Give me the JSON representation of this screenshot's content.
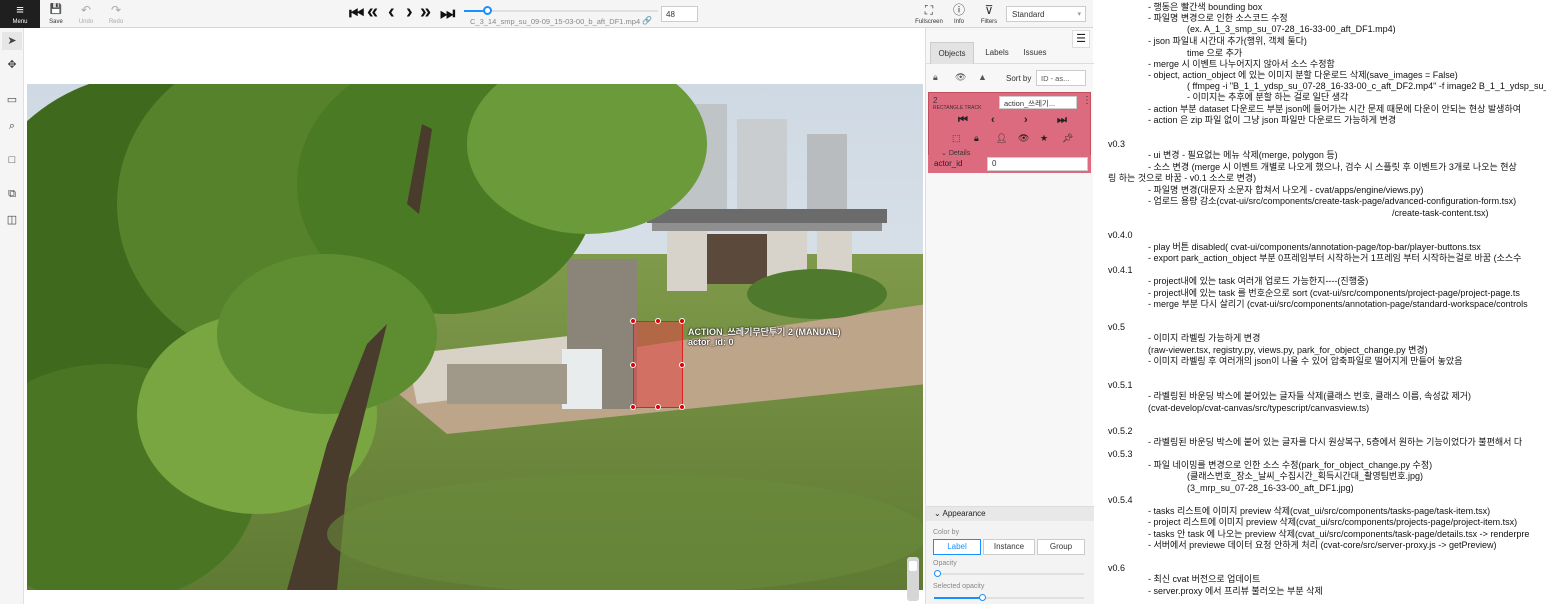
{
  "topbar": {
    "menu": {
      "icon": "≡",
      "label": "Menu"
    },
    "save": {
      "icon": "💾",
      "label": "Save"
    },
    "undo": {
      "icon": "↶",
      "label": "Undo"
    },
    "redo": {
      "icon": "↷",
      "label": "Redo"
    },
    "player": {
      "first": "⏮",
      "fast_back": "«",
      "back": "‹",
      "forward": "›",
      "fast_forward": "»",
      "last": "⏭"
    },
    "frame_progress": 0.12,
    "filename": "C_3_14_smp_su_09-09_15-03-00_b_aft_DF1.mp4",
    "frame_number": "48",
    "fullscreen": {
      "icon": "⛶",
      "label": "Fullscreen"
    },
    "info": {
      "icon": "ⓘ",
      "label": "Info"
    },
    "filters": {
      "icon": "⊽",
      "label": "Filters"
    },
    "workspace": "Standard"
  },
  "tools": [
    "cursor-icon",
    "move-icon",
    "rectangle-icon",
    "zoom-region-icon",
    "rectangle-icon",
    "merge-icon",
    "split-icon"
  ],
  "canvas": {
    "label_line1": "ACTION_쓰레기무단투기 2 (MANUAL)",
    "label_line2": "actor_id: 0"
  },
  "panel": {
    "tabs": [
      "Objects",
      "Labels",
      "Issues"
    ],
    "sort_label": "Sort by",
    "sort_value": "ID - as...",
    "object": {
      "id": "2",
      "kind": "RECTANGLE TRACK",
      "label": "action_쓰레기...",
      "details": "Details",
      "attr_name": "actor_id",
      "attr_value": "0"
    },
    "appearance": {
      "title": "Appearance",
      "color_by": "Color by",
      "options": [
        "Label",
        "Instance",
        "Group"
      ],
      "opacity": "Opacity",
      "opacity_value": 0.0,
      "selected_opacity": "Selected opacity",
      "selected_opacity_value": 0.32
    }
  },
  "notes": [
    "- 행동은 빨간색 bounding box",
    "- 파일명 변경으로 인한 소스코드 수정",
    "(ex. A_1_3_smp_su_07-28_16-33-00_aft_DF1.mp4)",
    "- json 파일내 시간대 추가(행위, 객체 둘다)",
    "time 으로 추가",
    "- merge 시 이벤트 나누어지지 않아서 소스 수정함",
    "- object, action_object 에 있는 이미지 분할 다운로드 삭제(save_images = False)",
    "( ffmpeg -i \"B_1_1_ydsp_su_07-28_16-33-00_c_aft_DF2.mp4\" -f image2 B_1_1_ydsp_su_07",
    "- 이미지는 추후에 분할 하는 걸로 일단 생각",
    "- action 부분 dataset 다운로드 부분 json에 들어가는 시간 문제 때문에 다운이 안되는 현상 발생하여",
    "- action 은 zip 파일 없이 그냥 json 파일만 다운로드 가능하게 변경",
    "v0.3",
    "- ui 변경 - 필요없는 메뉴 삭제(merge, polygon 등)",
    "- 소스 변경 (merge 시 이벤트 개별로 나오게 했으나, 검수 시 스플릿 후 이벤트가 3개로 나오는 현상",
    "링 하는 것으로 바꿈 - v0.1 소스로 변경)",
    "- 파일명 변경(대문자 소문자 합쳐서 나오게 - cvat/apps/engine/views.py)",
    "- 업로드 용량 감소(cvat-ui/src/components/create-task-page/advanced-configuration-form.tsx)",
    "/create-task-content.tsx)",
    "v0.4.0",
    "- play 버튼 disabled( cvat-ui/components/annotation-page/top-bar/player-buttons.tsx",
    "- export park_action_object 부분 0프레임부터 시작하는거 1프레임 부터 시작하는걸로 바꿈 (소스수",
    "v0.4.1",
    "- project내에 있는 task 여러개 업로드 가능한지----(진행중)",
    "- project내에 있는 task 를 번호순으로 sort (cvat-ui/src/components/project-page/project-page.ts",
    "- merge 부분 다시 살리기 (cvat-ui/src/components/annotation-page/standard-workspace/controls",
    "v0.5",
    "- 이미지 라벨링 가능하게 변경",
    "(raw-viewer.tsx, registry.py, views.py, park_for_object_change.py 변경)",
    "- 이미지 라벨링 후 여러개의 json이 나올 수 있어 압축파일로 떨어지게 만들어 놓았음",
    "v0.5.1",
    "- 라벨링된 바운딩 박스에 붙어있는 글자들 삭제(클래스 번호, 클래스 이름, 속성값 제거)",
    "(cvat-develop/cvat-canvas/src/typescript/canvasview.ts)",
    "v0.5.2",
    "- 라벨링된 바운딩 박스에 붙어 있는 글자를 다시 원상복구, 5층에서 원하는 기능이었다가 불편해서 다",
    "v0.5.3",
    "- 파일 네이밍를 변경으로 인한 소스 수정(park_for_object_change.py 수정)",
    "(클래스번호_장소_날씨_수집시간_획득시간대_촬영팀번호.jpg)",
    "(3_mrp_su_07-28_16-33-00_aft_DF1.jpg)",
    "v0.5.4",
    "- tasks 리스트에 이미지 preview 삭제(cvat_ui/src/components/tasks-page/task-item.tsx)",
    "- project 리스트에 이미지 preview 삭제(cvat_ui/src/components/projects-page/project-item.tsx)",
    "- tasks 안 task 에 나오는 preview 삭제(cvat_ui/src/components/task-page/details.tsx -> renderpre",
    "- 서버에서 previewe 데이터 요청 안하게 처리 (cvat-core/src/server-proxy.js -> getPreview)",
    "v0.6",
    "- 최신 cvat 버전으로 업데이트",
    "- server.proxy 에서 프리뷰 불러오는 부분 삭제"
  ]
}
